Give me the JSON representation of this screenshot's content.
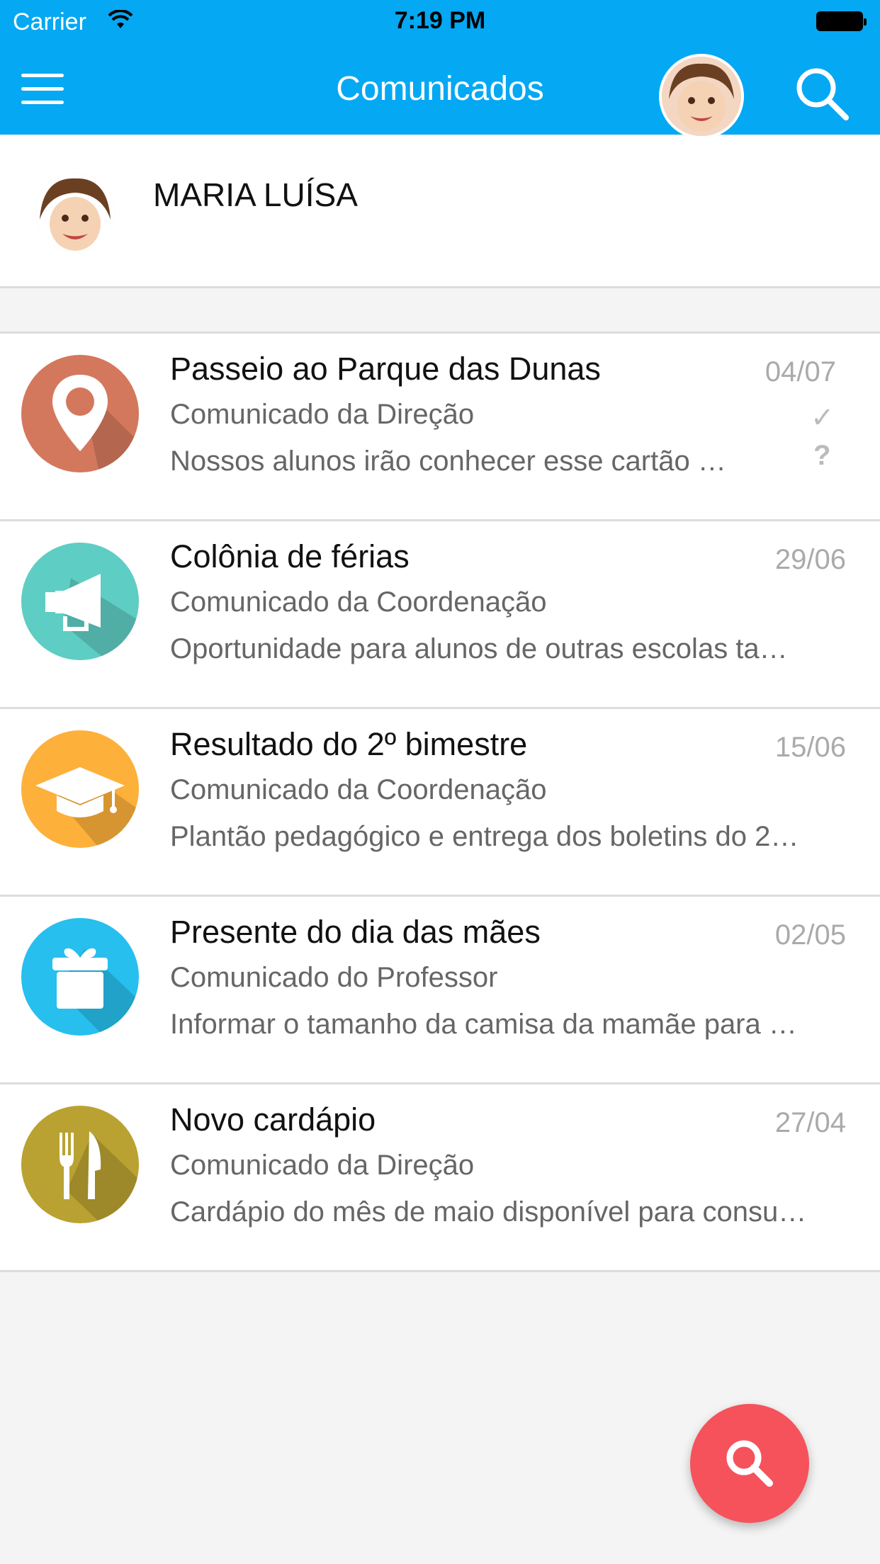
{
  "status_bar": {
    "carrier": "Carrier",
    "time": "7:19 PM"
  },
  "header": {
    "title": "Comunicados",
    "icons": [
      "menu-icon",
      "avatar",
      "search-icon"
    ]
  },
  "student": {
    "name": "MARIA LUÍSA"
  },
  "messages": [
    {
      "title": "Passeio ao Parque das Dunas",
      "subtitle": "Comunicado da Direção",
      "preview": "Nossos alunos irão conhecer esse cartão …",
      "date": "04/07",
      "icon": "location-pin-icon",
      "color": "#d4785d",
      "status_check": "✓",
      "status_question": "?"
    },
    {
      "title": "Colônia de férias",
      "subtitle": "Comunicado da Coordenação",
      "preview": "Oportunidade para alunos de outras escolas ta…",
      "date": "29/06",
      "icon": "megaphone-icon",
      "color": "#5ecdc4"
    },
    {
      "title": "Resultado do 2º bimestre",
      "subtitle": "Comunicado da Coordenação",
      "preview": "Plantão pedagógico e entrega dos boletins do 2…",
      "date": "15/06",
      "icon": "graduation-cap-icon",
      "color": "#fdb03a"
    },
    {
      "title": "Presente do dia das mães",
      "subtitle": "Comunicado do Professor",
      "preview": "Informar o tamanho da camisa da mamãe para …",
      "date": "02/05",
      "icon": "gift-icon",
      "color": "#27bfed"
    },
    {
      "title": "Novo cardápio",
      "subtitle": "Comunicado da Direção",
      "preview": "Cardápio do mês de maio disponível para consu…",
      "date": "27/04",
      "icon": "fork-knife-icon",
      "color": "#b9a232"
    }
  ],
  "fab": {
    "icon": "search-icon",
    "color": "#f5525c"
  },
  "colors": {
    "header": "#05a8f3",
    "background": "#f4f4f4"
  }
}
